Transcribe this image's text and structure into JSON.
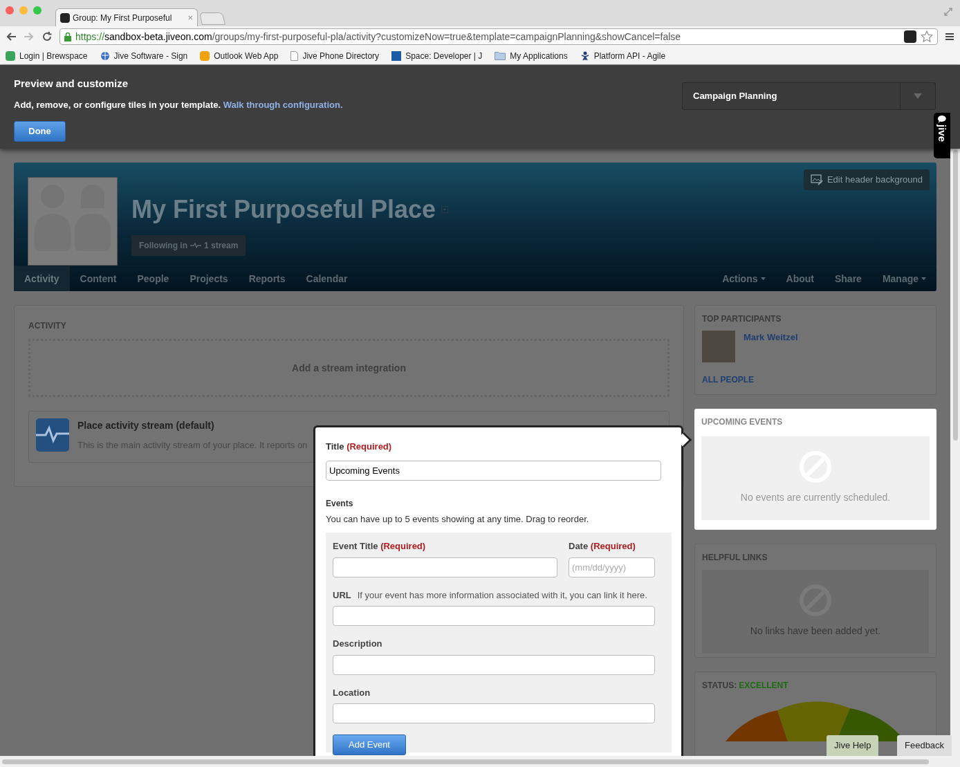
{
  "browser": {
    "tab_title": "Group: My First Purposeful",
    "tab_close": "×",
    "url_scheme": "https://",
    "url_host": "sandbox-beta.jiveon.com",
    "url_path": "/groups/my-first-purposeful-pla/activity?customizeNow=true&template=campaignPlanning&showCancel=false",
    "bookmarks": [
      {
        "label": "Login | Brewspace",
        "kind": "b"
      },
      {
        "label": "Jive Software - Sign",
        "kind": "globe"
      },
      {
        "label": "Outlook Web App",
        "kind": "outlook"
      },
      {
        "label": "Jive Phone Directory",
        "kind": "page"
      },
      {
        "label": "Space: Developer | J",
        "kind": "jive"
      },
      {
        "label": "My Applications",
        "kind": "folder"
      },
      {
        "label": "Platform API - Agile",
        "kind": "tool"
      }
    ]
  },
  "customize": {
    "title": "Preview and customize",
    "description": "Add, remove, or configure tiles in your template.",
    "link": "Walk through configuration.",
    "done_button": "Done",
    "template_select": "Campaign Planning"
  },
  "side_tab": "jive",
  "place": {
    "title": "My First Purposeful Place",
    "following": "Following in",
    "stream_count": "1 stream",
    "edit_background": "Edit header background",
    "nav_left": [
      {
        "label": "Activity",
        "selected": true
      },
      {
        "label": "Content",
        "selected": false
      },
      {
        "label": "People",
        "selected": false
      },
      {
        "label": "Projects",
        "selected": false
      },
      {
        "label": "Reports",
        "selected": false
      },
      {
        "label": "Calendar",
        "selected": false
      }
    ],
    "nav_right": [
      {
        "label": "Actions",
        "dropdown": true
      },
      {
        "label": "About",
        "dropdown": false
      },
      {
        "label": "Share",
        "dropdown": false
      },
      {
        "label": "Manage",
        "dropdown": true
      }
    ]
  },
  "activity": {
    "heading": "ACTIVITY",
    "add_stream": "Add a stream integration",
    "stream_title": "Place activity stream (default)",
    "stream_description": "This is the main activity stream of your place. It reports on"
  },
  "editor": {
    "title_label": "Title",
    "required": "(Required)",
    "title_value": "Upcoming Events",
    "events_heading": "Events",
    "events_hint": "You can have up to 5 events showing at any time. Drag to reorder.",
    "event_title_label": "Event Title",
    "event_title_required": "(Required)",
    "date_label": "Date",
    "date_required": "(Required)",
    "date_placeholder": "(mm/dd/yyyy)",
    "url_label": "URL",
    "url_hint": "If your event has more information associated with it, you can link it here.",
    "description_label": "Description",
    "location_label": "Location",
    "add_button": "Add Event"
  },
  "sidebar": {
    "participants_heading": "TOP PARTICIPANTS",
    "participant": "Mark Weitzel",
    "all_people": "ALL PEOPLE",
    "events_heading": "UPCOMING EVENTS",
    "events_empty": "No events are currently scheduled.",
    "links_heading": "HELPFUL LINKS",
    "links_empty": "No links have been added yet.",
    "status_label": "STATUS:",
    "status_value": "EXCELLENT"
  },
  "help_button": "Jive Help",
  "feedback_button": "Feedback"
}
